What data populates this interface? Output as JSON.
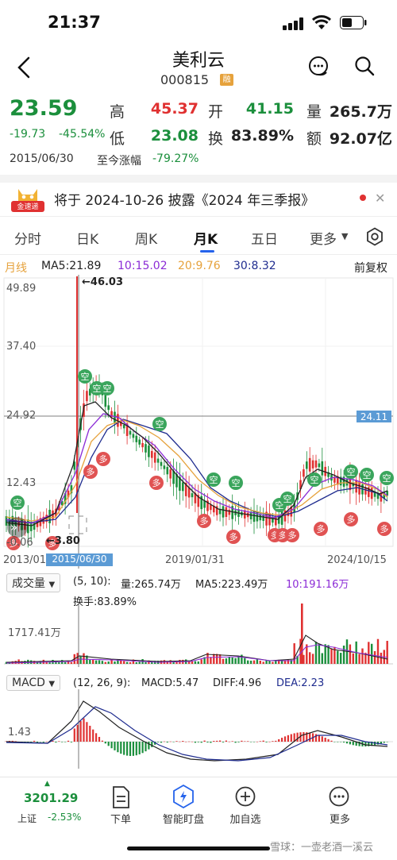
{
  "status_bar": {
    "time": "21:37"
  },
  "header": {
    "name": "美利云",
    "code": "000815",
    "margin_badge": "融"
  },
  "quote": {
    "price": "23.59",
    "change": "-19.73",
    "change_pct": "-45.54%",
    "high_label": "高",
    "high": "45.37",
    "open_label": "开",
    "open": "41.15",
    "volume_label": "量",
    "volume": "265.7万",
    "low_label": "低",
    "low": "23.08",
    "turnover_label": "换",
    "turnover": "83.89%",
    "amount_label": "额",
    "amount": "92.07亿",
    "date": "2015/06/30",
    "since_label": "至今涨幅",
    "since_value": "-79.27%"
  },
  "notice": {
    "badge": "金速递",
    "text": "将于 2024-10-26 披露《2024 年三季报》"
  },
  "tabs": [
    "分时",
    "日K",
    "周K",
    "月K",
    "五日",
    "更多"
  ],
  "active_tab": "月K",
  "ma_line": {
    "period": "月线",
    "ma5": "MA5:21.89",
    "ma10": "10:15.02",
    "ma20": "20:9.76",
    "ma30": "30:8.32",
    "adjust": "前复权"
  },
  "colors": {
    "up": "#e03131",
    "down": "#1b8f3c",
    "ma5": "#222222",
    "ma10": "#8b2bd6",
    "ma20": "#e6a23c",
    "ma30": "#1f2c8f",
    "accent": "#2563eb"
  },
  "price_chart": {
    "y_ticks": [
      "49.89",
      "37.40",
      "24.92",
      "12.43",
      "-0.06"
    ],
    "price_tag": "24.11",
    "high_marker": "←46.03",
    "low_marker": "←3.80",
    "x_labels": [
      "2013/01",
      "2015/06/30",
      "2019/01/31",
      "2024/10/15"
    ],
    "signal_short": "空",
    "signal_long": "多"
  },
  "volume_panel": {
    "selector": "成交量",
    "params": "(5, 10):",
    "vol": "量:265.74万",
    "ma5": "MA5:223.49万",
    "ma10": "10:191.16万",
    "turnover": "换手:83.89%",
    "y_tick": "1717.41万"
  },
  "macd_panel": {
    "selector": "MACD",
    "params": "(12, 26, 9):",
    "macd": "MACD:5.47",
    "diff": "DIFF:4.96",
    "dea": "DEA:2.23",
    "y_tick": "1.43"
  },
  "bottom_bar": {
    "index_value": "3201.29",
    "index_name": "上证",
    "index_change": "-2.53%",
    "order": "下单",
    "smart": "智能盯盘",
    "watch": "加自选",
    "more": "更多"
  },
  "watermark": "雪球：一壶老酒一溪云"
}
